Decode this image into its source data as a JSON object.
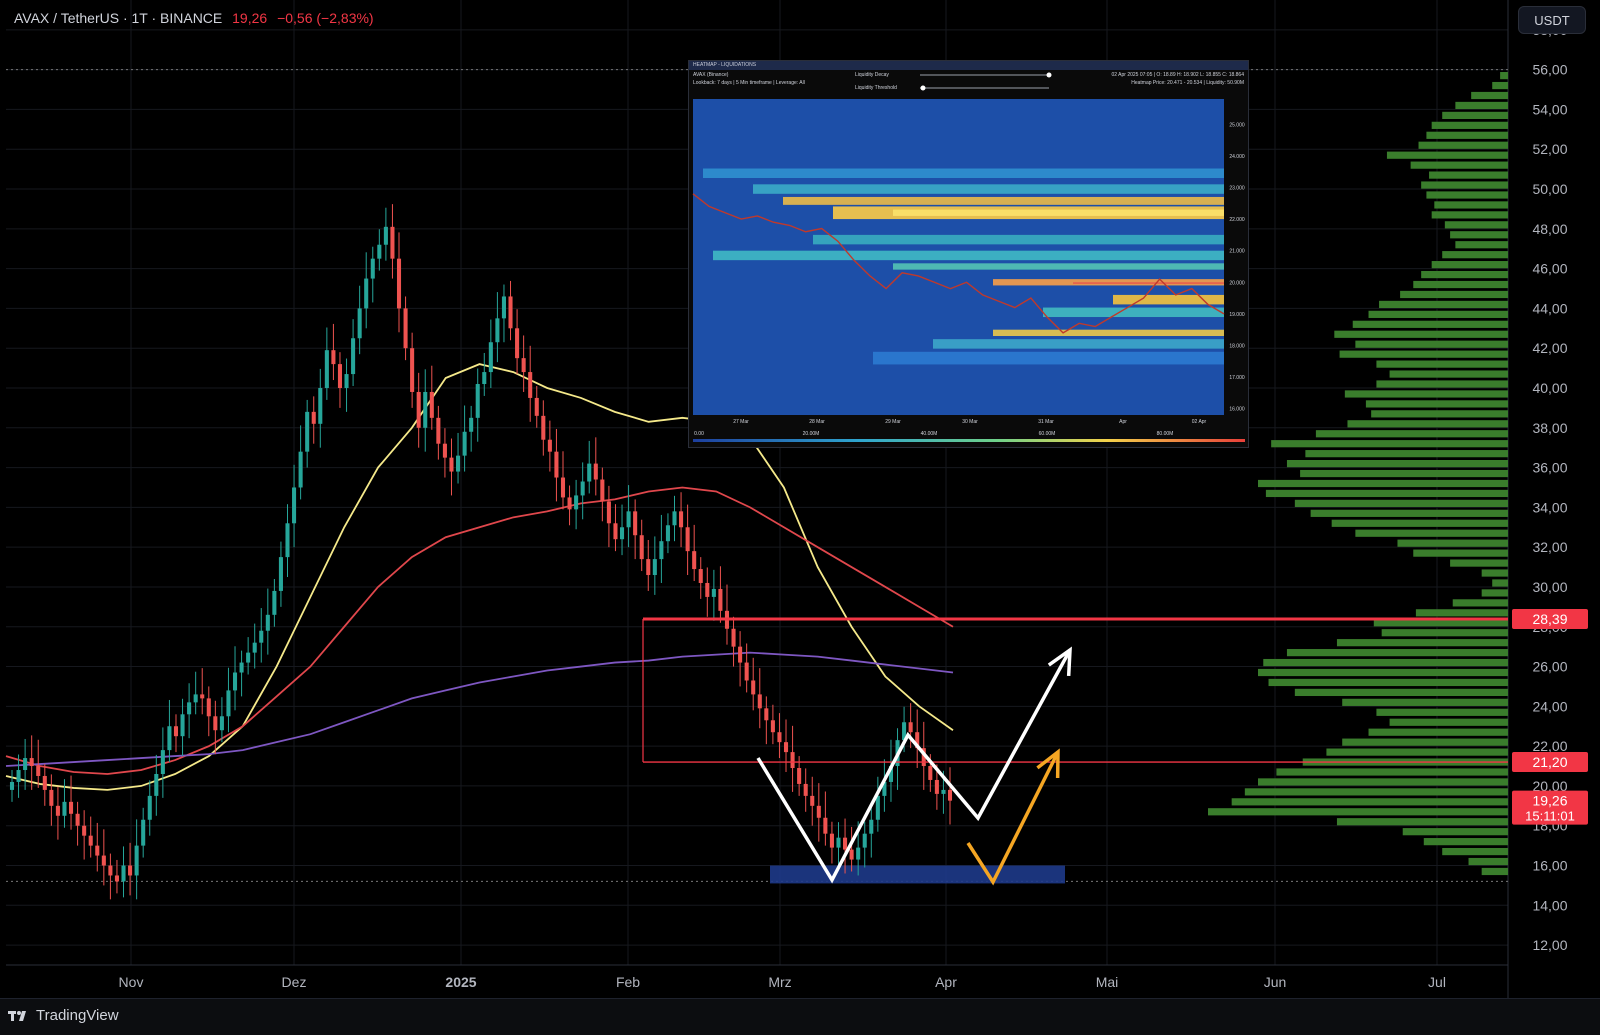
{
  "header": {
    "symbol": "AVAX / TetherUS · 1T · BINANCE",
    "price": "19,26",
    "change": "−0,56 (−2,83%)"
  },
  "currency_button": "USDT",
  "footer": {
    "brand": "TradingView"
  },
  "colors": {
    "bull": "#26a69a",
    "bear": "#ef5350",
    "ma_fast": "#f5e98a",
    "ma_mid": "#e0474c",
    "ma_slow": "#7e57c2",
    "volume_profile": "#3a7d2c",
    "level_red": "#f23645",
    "support_zone": "#1e3a8a"
  },
  "chart_data": [
    {
      "type": "candlestick",
      "title": "AVAX / TetherUS · 1T · BINANCE",
      "x_ticks": [
        "Nov",
        "Dez",
        "2025",
        "Feb",
        "Mrz",
        "Apr",
        "Mai",
        "Jun",
        "Jul"
      ],
      "y_ticks": [
        "58,00",
        "56,00",
        "54,00",
        "52,00",
        "50,00",
        "48,00",
        "46,00",
        "44,00",
        "42,00",
        "40,00",
        "38,00",
        "36,00",
        "34,00",
        "32,00",
        "30,00",
        "28,00",
        "26,00",
        "24,00",
        "22,00",
        "20,00",
        "18,00",
        "16,00",
        "14,00",
        "12,00"
      ],
      "ylim": [
        11,
        59.5
      ],
      "price_labels": [
        {
          "value": 28.39,
          "text": "28,39"
        },
        {
          "value": 21.2,
          "text": "21,20"
        },
        {
          "value": 19.26,
          "text": "19,26",
          "countdown": "15:11:01"
        }
      ],
      "horizontal_levels": [
        28.39,
        21.2
      ],
      "support_zone": [
        15.1,
        16.0
      ],
      "dotted_levels": [
        56.0,
        15.2
      ],
      "candles_close": [
        20.2,
        20.8,
        21.4,
        21.0,
        20.5,
        19.8,
        19.0,
        18.5,
        19.2,
        18.6,
        18.0,
        17.5,
        17.0,
        16.5,
        16.0,
        15.5,
        15.2,
        16.0,
        15.5,
        17.0,
        18.3,
        19.5,
        20.6,
        21.8,
        23.0,
        22.5,
        23.6,
        24.2,
        24.6,
        24.4,
        23.5,
        22.8,
        23.5,
        24.8,
        25.7,
        26.2,
        26.7,
        27.2,
        27.8,
        28.6,
        29.8,
        31.5,
        33.2,
        35.0,
        36.8,
        38.8,
        38.2,
        40.0,
        41.9,
        41.2,
        40.0,
        40.7,
        42.5,
        44.0,
        45.5,
        46.5,
        47.2,
        48.1,
        46.5,
        44.0,
        42.0,
        39.8,
        38.0,
        39.8,
        38.5,
        37.2,
        36.5,
        35.8,
        36.6,
        37.8,
        38.5,
        40.2,
        40.8,
        42.3,
        43.5,
        44.6,
        43.0,
        41.5,
        40.8,
        39.5,
        38.6,
        37.4,
        36.8,
        35.5,
        34.5,
        33.9,
        34.6,
        35.3,
        36.2,
        35.4,
        34.3,
        33.2,
        32.4,
        33.0,
        33.8,
        32.6,
        31.4,
        30.6,
        31.4,
        32.3,
        33.1,
        33.8,
        33.0,
        31.8,
        30.9,
        30.2,
        29.5,
        29.9,
        28.8,
        27.9,
        27.0,
        26.2,
        25.3,
        24.6,
        23.9,
        23.3,
        22.7,
        22.2,
        21.7,
        20.9,
        20.1,
        19.5,
        19.0,
        18.4,
        17.6,
        16.9,
        17.4,
        16.8,
        16.3,
        16.9,
        17.6,
        18.3,
        19.5,
        20.2,
        21.0,
        22.3,
        23.2,
        22.7,
        21.9,
        21.0,
        20.3,
        19.6,
        19.8,
        19.26
      ],
      "moving_averages": [
        {
          "values": [
            20.5,
            20.1,
            19.9,
            19.8,
            20.0,
            20.6,
            21.5,
            23.0,
            26.0,
            29.5,
            33.0,
            36.0,
            38.0,
            40.5,
            41.2,
            40.8,
            40.0,
            39.5,
            38.8,
            38.3,
            38.5,
            38.3,
            37.5,
            35.0,
            31.0,
            28.0,
            25.5,
            24.0,
            22.8
          ]
        },
        {
          "values": [
            21.5,
            21.0,
            20.7,
            20.6,
            20.8,
            21.3,
            22.0,
            23.0,
            24.5,
            26.0,
            28.0,
            30.0,
            31.5,
            32.5,
            33.0,
            33.5,
            33.8,
            34.2,
            34.4,
            34.8,
            35.0,
            34.8,
            34.0,
            33.0,
            32.0,
            31.0,
            30.0,
            29.0,
            28.0
          ]
        },
        {
          "values": [
            21.0,
            21.1,
            21.2,
            21.3,
            21.4,
            21.5,
            21.6,
            21.8,
            22.2,
            22.6,
            23.2,
            23.8,
            24.4,
            24.8,
            25.2,
            25.5,
            25.8,
            26.0,
            26.2,
            26.3,
            26.5,
            26.6,
            26.7,
            26.6,
            26.5,
            26.3,
            26.1,
            25.9,
            25.7
          ]
        }
      ],
      "volume_profile": [
        [
          55.7,
          0.3
        ],
        [
          55.2,
          0.6
        ],
        [
          54.7,
          1.4
        ],
        [
          54.2,
          2.0
        ],
        [
          53.7,
          2.5
        ],
        [
          53.2,
          2.9
        ],
        [
          52.7,
          3.1
        ],
        [
          52.2,
          3.4
        ],
        [
          51.7,
          4.6
        ],
        [
          51.2,
          3.7
        ],
        [
          50.7,
          3.0
        ],
        [
          50.2,
          3.3
        ],
        [
          49.7,
          3.1
        ],
        [
          49.2,
          2.8
        ],
        [
          48.7,
          2.9
        ],
        [
          48.2,
          2.4
        ],
        [
          47.7,
          2.2
        ],
        [
          47.2,
          2.0
        ],
        [
          46.7,
          2.5
        ],
        [
          46.2,
          2.9
        ],
        [
          45.7,
          3.3
        ],
        [
          45.2,
          3.6
        ],
        [
          44.7,
          4.1
        ],
        [
          44.2,
          4.9
        ],
        [
          43.7,
          5.3
        ],
        [
          43.2,
          5.9
        ],
        [
          42.7,
          6.6
        ],
        [
          42.2,
          5.8
        ],
        [
          41.7,
          6.4
        ],
        [
          41.2,
          5.0
        ],
        [
          40.7,
          4.5
        ],
        [
          40.2,
          5.0
        ],
        [
          39.7,
          6.2
        ],
        [
          39.2,
          5.4
        ],
        [
          38.7,
          5.2
        ],
        [
          38.2,
          6.1
        ],
        [
          37.7,
          7.3
        ],
        [
          37.2,
          9.0
        ],
        [
          36.7,
          7.7
        ],
        [
          36.2,
          8.4
        ],
        [
          35.7,
          7.9
        ],
        [
          35.2,
          9.5
        ],
        [
          34.7,
          9.2
        ],
        [
          34.2,
          8.1
        ],
        [
          33.7,
          7.5
        ],
        [
          33.2,
          6.7
        ],
        [
          32.7,
          5.8
        ],
        [
          32.2,
          4.2
        ],
        [
          31.7,
          3.6
        ],
        [
          31.2,
          2.2
        ],
        [
          30.7,
          1.0
        ],
        [
          30.2,
          0.6
        ],
        [
          29.7,
          1.0
        ],
        [
          29.2,
          2.1
        ],
        [
          28.7,
          3.5
        ],
        [
          28.2,
          5.1
        ],
        [
          27.7,
          4.8
        ],
        [
          27.2,
          6.5
        ],
        [
          26.7,
          8.4
        ],
        [
          26.2,
          9.3
        ],
        [
          25.7,
          9.5
        ],
        [
          25.2,
          9.1
        ],
        [
          24.7,
          8.1
        ],
        [
          24.2,
          6.3
        ],
        [
          23.7,
          5.0
        ],
        [
          23.2,
          4.5
        ],
        [
          22.7,
          5.3
        ],
        [
          22.2,
          6.3
        ],
        [
          21.7,
          6.9
        ],
        [
          21.2,
          7.8
        ],
        [
          20.7,
          8.8
        ],
        [
          20.2,
          9.5
        ],
        [
          19.7,
          10.0
        ],
        [
          19.2,
          10.5
        ],
        [
          18.7,
          11.4
        ],
        [
          18.2,
          6.5
        ],
        [
          17.7,
          4.0
        ],
        [
          17.2,
          3.2
        ],
        [
          16.7,
          2.5
        ],
        [
          16.2,
          1.5
        ],
        [
          15.7,
          1.0
        ]
      ],
      "annotations": [
        {
          "type": "white-projection",
          "points": [
            [
              758,
              758
            ],
            [
              832,
              880
            ],
            [
              908,
              735
            ],
            [
              978,
              818
            ],
            [
              1070,
              650
            ]
          ]
        },
        {
          "type": "orange-projection",
          "points": [
            [
              968,
              843
            ],
            [
              993,
              882
            ],
            [
              1058,
              752
            ]
          ]
        }
      ]
    },
    {
      "type": "heatmap",
      "title": "HEATMAP - LIQUIDATIONS",
      "header_left": [
        "AVAX (Binance)",
        "Lookback: 7 days | 5 Min timeframe | Leverage: All"
      ],
      "controls": [
        "Liquidity Decay",
        "Liquidity Threshold"
      ],
      "header_right": [
        "02 Apr 2025 07:05 | O: 18.89 H: 18.902 L: 18.855 C: 18.864",
        "Heatmap Price: 20.471 - 20.534 | Liquidity: 50.90M"
      ],
      "x_ticks": [
        "27 Mar",
        "28 Mar",
        "29 Mar",
        "30 Mar",
        "31 Mar",
        "Apr",
        "02 Apr"
      ],
      "y_ticks": [
        "25.000",
        "24.000",
        "23.000",
        "22.000",
        "21.000",
        "20.000",
        "19.000",
        "18.000",
        "17.000",
        "16.000"
      ],
      "colorbar_ticks": [
        "0.00",
        "20.00M",
        "40.00M",
        "60.00M",
        "80.00M"
      ],
      "price_path": [
        22.8,
        22.4,
        22.2,
        22.0,
        22.1,
        21.9,
        21.8,
        21.6,
        21.7,
        21.3,
        20.7,
        20.2,
        19.8,
        20.3,
        20.2,
        20.0,
        19.8,
        20.0,
        19.6,
        19.4,
        19.2,
        19.5,
        18.9,
        18.4,
        18.7,
        18.6,
        18.9,
        19.2,
        19.5,
        20.1,
        19.6,
        19.8,
        19.3,
        19.0
      ]
    }
  ]
}
